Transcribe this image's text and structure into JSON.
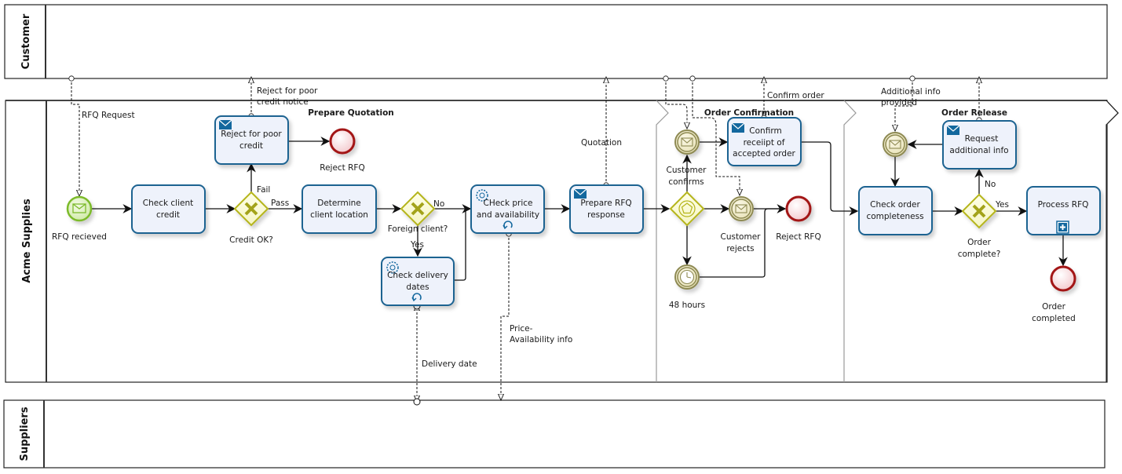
{
  "pools": [
    {
      "id": "customer",
      "name": "Customer"
    },
    {
      "id": "acme",
      "name": "Acme Supplies"
    },
    {
      "id": "suppliers",
      "name": "Suppliers"
    }
  ],
  "phases": [
    {
      "id": "prepare",
      "title": "Prepare Quotation"
    },
    {
      "id": "confirm",
      "title": "Order Confirmation"
    },
    {
      "id": "release",
      "title": "Order Release"
    }
  ],
  "tasks": {
    "check_credit": [
      "Check client",
      "credit"
    ],
    "reject_poor": [
      "Reject for poor",
      "credit"
    ],
    "determine_loc": [
      "Determine",
      "client location"
    ],
    "check_price": [
      "CHeck price",
      "and availability"
    ],
    "check_delivery": [
      "Check delivery",
      "dates"
    ],
    "prepare_rfq": [
      "Prepare RFQ",
      "response"
    ],
    "confirm_receipt": [
      "Confirm",
      "receiipt of",
      "accepted order"
    ],
    "check_complete": [
      "Check order",
      "completeness"
    ],
    "request_info": [
      "Request",
      "additional info"
    ],
    "process_rfq": [
      "Process RFQ"
    ]
  },
  "events": {
    "rfq_received": "RFQ recieved",
    "reject_rfq_1": "Reject RFQ",
    "customer_confirms": [
      "Customer",
      "confirms"
    ],
    "customer_rejects": [
      "Customer",
      "rejects"
    ],
    "hours48": "48 hours",
    "reject_rfq_2": "Reject RFQ",
    "order_completed": [
      "Order",
      "completed"
    ]
  },
  "gateways": {
    "credit_ok": "Credit OK?",
    "foreign": "Foreign client?",
    "order_complete": [
      "Order",
      "complete?"
    ]
  },
  "flow_labels": {
    "fail": "Fail",
    "pass": "Pass",
    "no1": "No",
    "yes1": "Yes",
    "no2": "No",
    "yes2": "Yes"
  },
  "messages": {
    "rfq_request": "RFQ Request",
    "reject_notice": [
      "Reject for poor",
      "credit notice"
    ],
    "quotation": "Quotation",
    "confirm_order": "Confirm order",
    "additional_info": [
      "Additional info",
      "provided"
    ],
    "delivery_date": "Delivery date",
    "price_avail": [
      "Price-",
      "Availability info"
    ]
  },
  "colors": {
    "task_border": "#1f6391",
    "task_fill": "#eef2fb",
    "start_event": "#7cbb2c",
    "end_event": "#a31515",
    "gateway": "#b5b51a",
    "intermediate": "#8e8a52",
    "icon_blue": "#13689e"
  }
}
